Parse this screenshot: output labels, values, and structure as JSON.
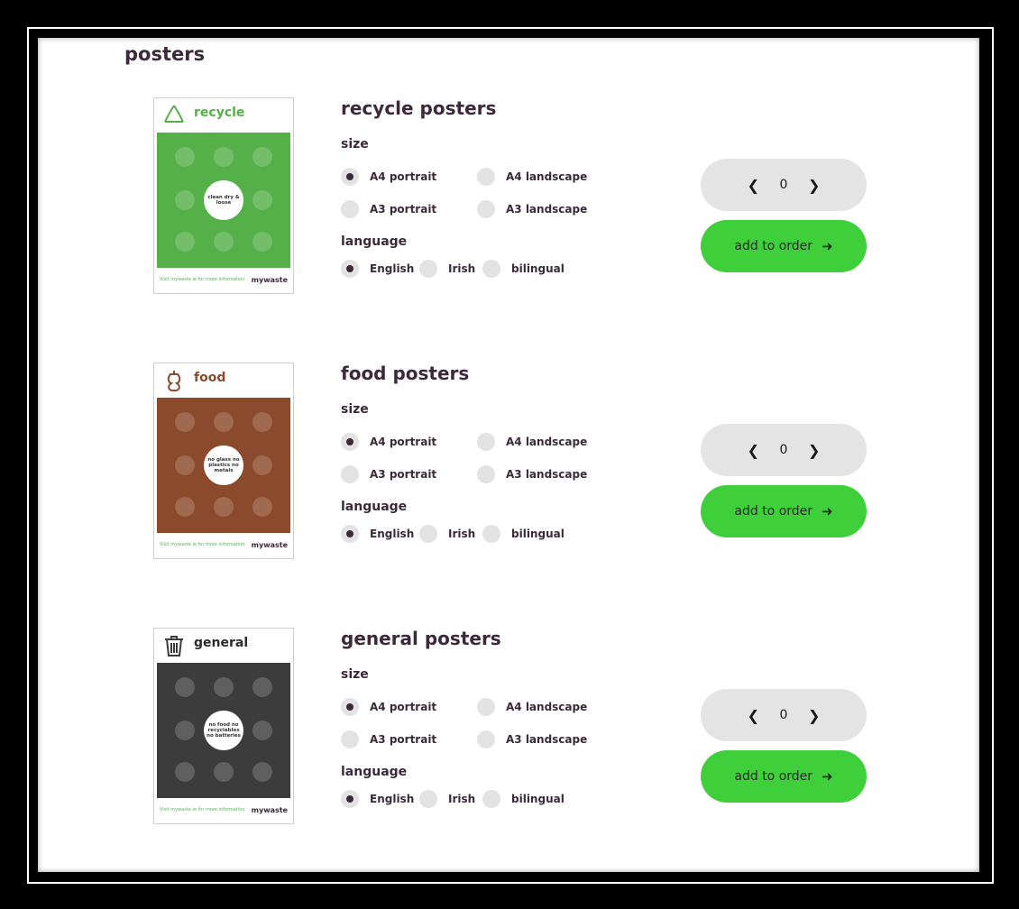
{
  "page": {
    "title": "posters"
  },
  "colors": {
    "accent": "#3ecf3a",
    "text": "#3b2a3a",
    "recycle": "#56b04a",
    "food": "#8b4a2b",
    "general": "#3c3c3c"
  },
  "products": [
    {
      "title": "recycle posters",
      "thumb": {
        "name": "recycle",
        "icon": "recycle-icon",
        "badge": "clean dry & loose",
        "foot_left": "Visit mywaste.ie for more information",
        "brand": "mywaste"
      },
      "size_label": "size",
      "sizes": [
        "A4 portrait",
        "A4 landscape",
        "A3 portrait",
        "A3 landscape"
      ],
      "selected_size": "A4 portrait",
      "language_label": "language",
      "languages": [
        "English",
        "Irish",
        "bilingual"
      ],
      "selected_language": "English",
      "quantity": "0",
      "add_label": "add to order"
    },
    {
      "title": "food posters",
      "thumb": {
        "name": "food",
        "icon": "apple-core-icon",
        "badge": "no glass no plastics no metals",
        "foot_left": "Visit mywaste.ie for more information",
        "brand": "mywaste"
      },
      "size_label": "size",
      "sizes": [
        "A4 portrait",
        "A4 landscape",
        "A3 portrait",
        "A3 landscape"
      ],
      "selected_size": "A4 portrait",
      "language_label": "language",
      "languages": [
        "English",
        "Irish",
        "bilingual"
      ],
      "selected_language": "English",
      "quantity": "0",
      "add_label": "add to order"
    },
    {
      "title": "general posters",
      "thumb": {
        "name": "general",
        "icon": "bin-icon",
        "badge": "no food no recyclables no batteries",
        "foot_left": "Visit mywaste.ie for more information",
        "brand": "mywaste"
      },
      "size_label": "size",
      "sizes": [
        "A4 portrait",
        "A4 landscape",
        "A3 portrait",
        "A3 landscape"
      ],
      "selected_size": "A4 portrait",
      "language_label": "language",
      "languages": [
        "English",
        "Irish",
        "bilingual"
      ],
      "selected_language": "English",
      "quantity": "0",
      "add_label": "add to order"
    }
  ]
}
